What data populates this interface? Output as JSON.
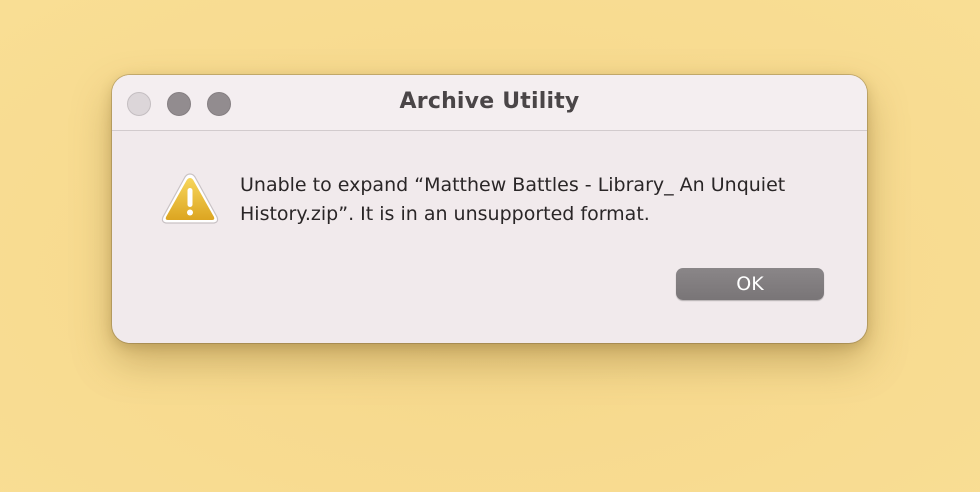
{
  "dialog": {
    "title": "Archive Utility",
    "message": "Unable to expand “Matthew Battles - Library_ An Unquiet History.zip”. It is in an unsupported format.",
    "icon": "warning-triangle-icon",
    "ok_label": "OK"
  },
  "colors": {
    "desktop_background": "#f7da8f",
    "dialog_background": "#f1eaec",
    "button_background": "#7f7b7d",
    "warning_yellow": "#e7b52a"
  }
}
